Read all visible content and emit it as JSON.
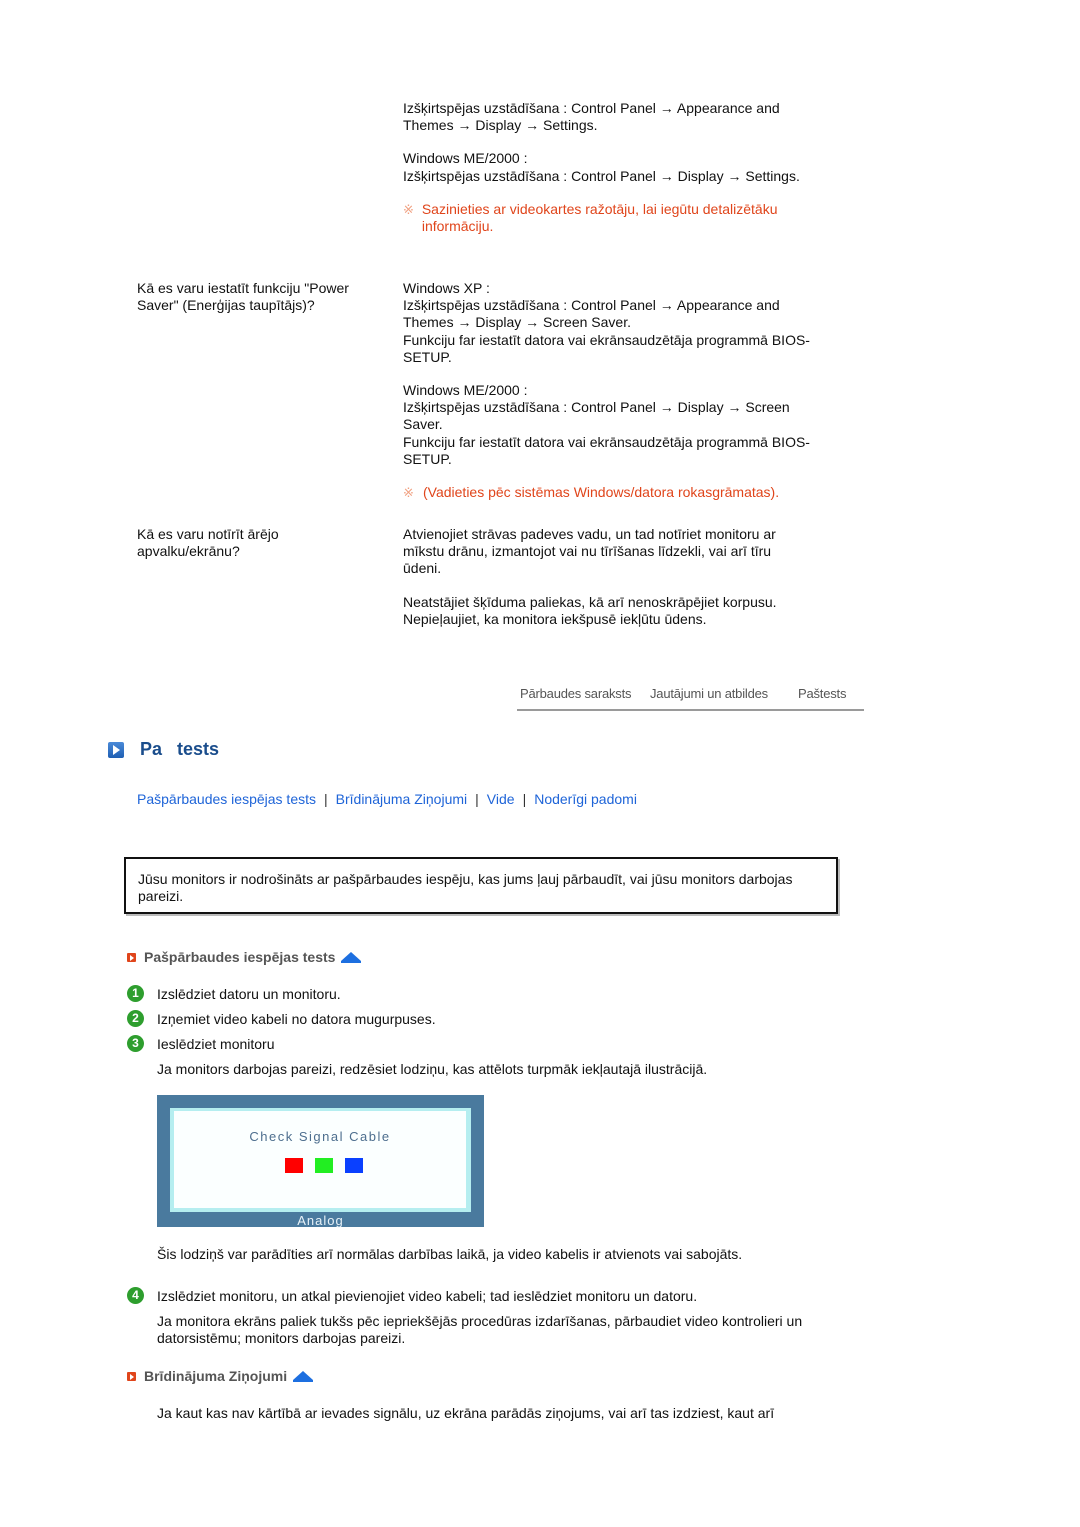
{
  "faq": {
    "resolution_answer_cont": {
      "xp_path": "Izšķirtspējas uzstādīšana : Control Panel → Appearance and Themes → Display → Settings.",
      "me_label": "Windows ME/2000 :",
      "me_path": "Izšķirtspējas uzstādīšana : Control Panel → Display → Settings.",
      "note": "Sazinieties ar videokartes ražotāju, lai iegūtu detalizētāku informāciju."
    },
    "power_saver": {
      "question": "Kā es varu iestatīt funkciju \"Power Saver\" (Enerģijas taupītājs)?",
      "xp_label": "Windows XP :",
      "xp_path": "Izšķirtspējas uzstādīšana : Control Panel → Appearance and Themes → Display → Screen Saver.",
      "xp_bios": "Funkciju far iestatīt datora vai ekrānsaudzētāja programmā BIOS-SETUP.",
      "me_label": "Windows ME/2000 :",
      "me_path": "Izšķirtspējas uzstādīšana : Control Panel → Display → Screen Saver.",
      "me_bios": "Funkciju far iestatīt datora vai ekrānsaudzētāja programmā BIOS-SETUP.",
      "note": "(Vadieties pēc sistēmas Windows/datora rokasgrāmatas)."
    },
    "cleaning": {
      "question": "Kā es varu notīrīt ārējo apvalku/ekrānu?",
      "answer_1": "Atvienojiet strāvas padeves vadu, un tad notīriet monitoru ar mīkstu drānu, izmantojot vai nu tīrīšanas līdzekli, vai arī tīru ūdeni.",
      "answer_2": "Neatstājiet šķīduma paliekas, kā arī nenoskrāpējiet korpusu. Nepieļaujiet, ka monitora iekšpusē iekļūtu ūdens."
    }
  },
  "tabs": [
    "Pārbaudes saraksts",
    "Jautājumi un atbildes",
    "Paštests"
  ],
  "page_title": "Pa   tests",
  "links": [
    "Pašpārbaudes iespējas tests",
    "Brīdinājuma Ziņojumi",
    "Vide",
    "Noderīgi padomi"
  ],
  "intro": "Jūsu monitors ir nodrošināts ar pašpārbaudes iespēju, kas jums ļauj pārbaudīt, vai jūsu monitors darbojas pareizi.",
  "self_test": {
    "heading": "Pašpārbaudes iespējas tests",
    "steps": [
      {
        "num": "1",
        "text": "Izslēdziet datoru un monitoru."
      },
      {
        "num": "2",
        "text": "Izņemiet video kabeli no datora mugurpuses."
      },
      {
        "num": "3",
        "text": "Ieslēdziet monitoru"
      },
      {
        "num": "4",
        "text": "Izslēdziet monitoru, un atkal pievienojiet video kabeli; tad ieslēdziet monitoru un datoru."
      }
    ],
    "step3_detail": "Ja monitors darbojas pareizi, redzēsiet lodziņu, kas attēlots turpmāk iekļautajā ilustrācijā.",
    "monitor_message": "Check Signal Cable",
    "monitor_label": "Analog",
    "color_squares": [
      "#ff0000",
      "#22ee22",
      "#0a40ff"
    ],
    "after_image": "Šis lodziņš var parādīties arī normālas darbības laikā, ja video kabelis ir atvienots vai sabojāts.",
    "step4_detail": "Ja monitora ekrāns paliek tukšs pēc iepriekšējās procedūras izdarīšanas, pārbaudiet video kontrolieri un datorsistēmu; monitors darbojas pareizi."
  },
  "warnings": {
    "heading": "Brīdinājuma Ziņojumi",
    "text": "Ja kaut kas nav kārtībā ar ievades signālu, uz ekrāna parādās ziņojums, vai arī tas izdziest, kaut arī"
  },
  "icons": {
    "note": "※",
    "up_arrow": "up-triangle-icon"
  }
}
